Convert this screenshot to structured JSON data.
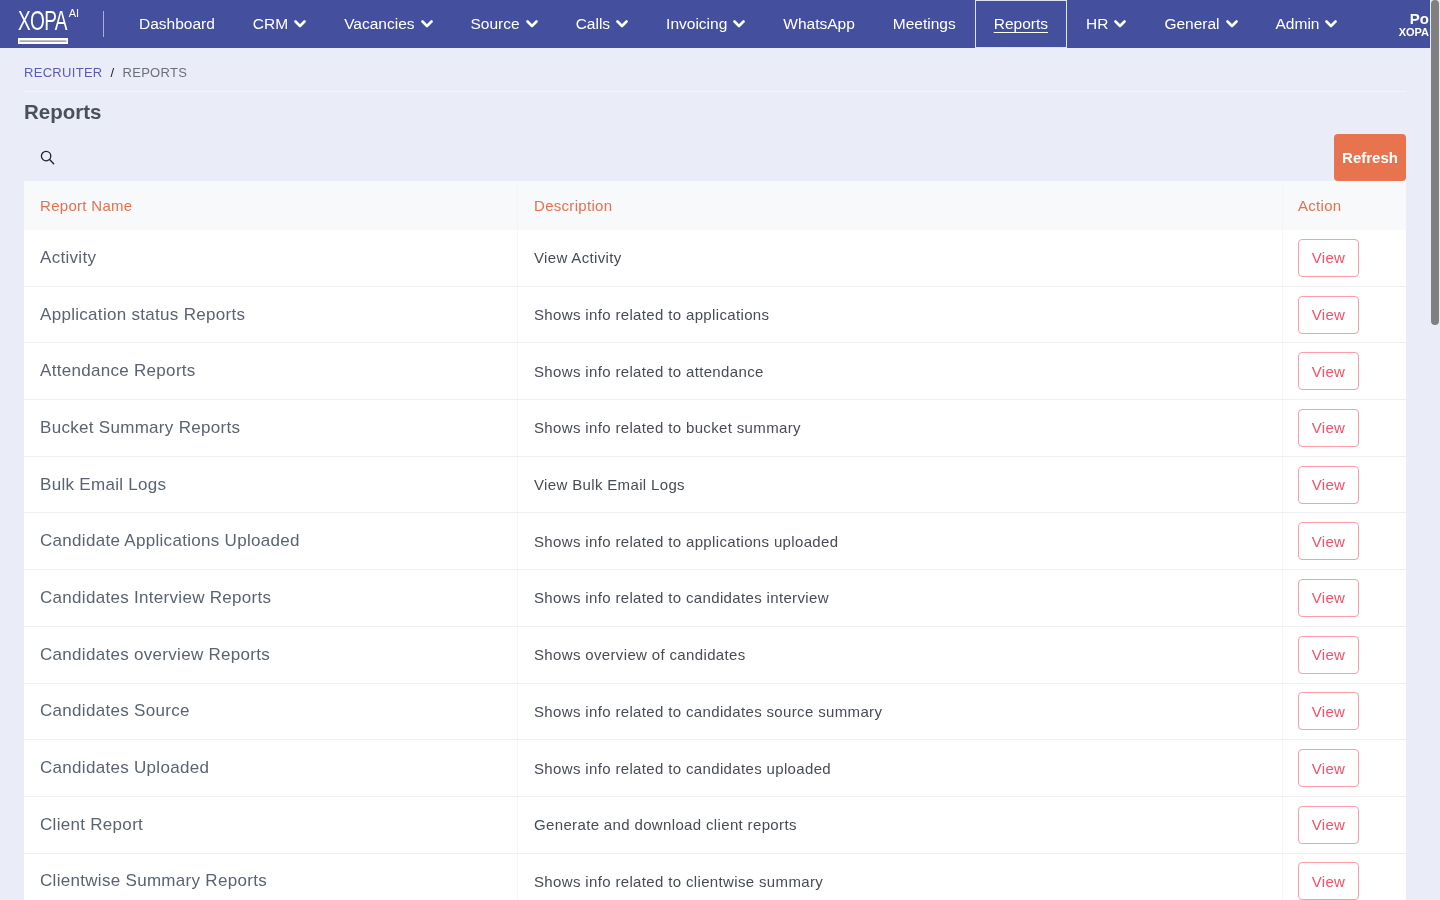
{
  "nav": {
    "logo": {
      "text": "XOPA",
      "superscript": "AI"
    },
    "items": [
      {
        "label": "Dashboard",
        "has_menu": false,
        "selected": false
      },
      {
        "label": "CRM",
        "has_menu": true,
        "selected": false
      },
      {
        "label": "Vacancies",
        "has_menu": true,
        "selected": false
      },
      {
        "label": "Source",
        "has_menu": true,
        "selected": false
      },
      {
        "label": "Calls",
        "has_menu": true,
        "selected": false
      },
      {
        "label": "Invoicing",
        "has_menu": true,
        "selected": false
      },
      {
        "label": "WhatsApp",
        "has_menu": false,
        "selected": false
      },
      {
        "label": "Meetings",
        "has_menu": false,
        "selected": false
      },
      {
        "label": "Reports",
        "has_menu": false,
        "selected": true
      },
      {
        "label": "HR",
        "has_menu": true,
        "selected": false
      },
      {
        "label": "General",
        "has_menu": true,
        "selected": false
      },
      {
        "label": "Admin",
        "has_menu": true,
        "selected": false
      }
    ],
    "user": {
      "name": "Po",
      "org": "XOPA"
    }
  },
  "breadcrumb": {
    "items": [
      {
        "label": "RECRUITER",
        "kind": "link"
      },
      {
        "label": "REPORTS",
        "kind": "current"
      }
    ],
    "separator": "/"
  },
  "page_title": "Reports",
  "toolbar": {
    "refresh_button": "Refresh"
  },
  "table": {
    "columns": [
      "Report Name",
      "Description",
      "Action"
    ],
    "rows": [
      {
        "name": "Activity",
        "description": "View Activity",
        "action": "View"
      },
      {
        "name": "Application status Reports",
        "description": "Shows info related to applications",
        "action": "View"
      },
      {
        "name": "Attendance Reports",
        "description": "Shows info related to attendance",
        "action": "View"
      },
      {
        "name": "Bucket Summary Reports",
        "description": "Shows info related to bucket summary",
        "action": "View"
      },
      {
        "name": "Bulk Email Logs",
        "description": "View Bulk Email Logs",
        "action": "View"
      },
      {
        "name": "Candidate Applications Uploaded",
        "description": "Shows info related to applications uploaded",
        "action": "View"
      },
      {
        "name": "Candidates Interview Reports",
        "description": "Shows info related to candidates interview",
        "action": "View"
      },
      {
        "name": "Candidates overview Reports",
        "description": "Shows overview of candidates",
        "action": "View"
      },
      {
        "name": "Candidates Source",
        "description": "Shows info related to candidates source summary",
        "action": "View"
      },
      {
        "name": "Candidates Uploaded",
        "description": "Shows info related to candidates uploaded",
        "action": "View"
      },
      {
        "name": "Client Report",
        "description": "Generate and download client reports",
        "action": "View"
      },
      {
        "name": "Clientwise Summary Reports",
        "description": "Shows info related to clientwise summary",
        "action": "View"
      }
    ]
  }
}
